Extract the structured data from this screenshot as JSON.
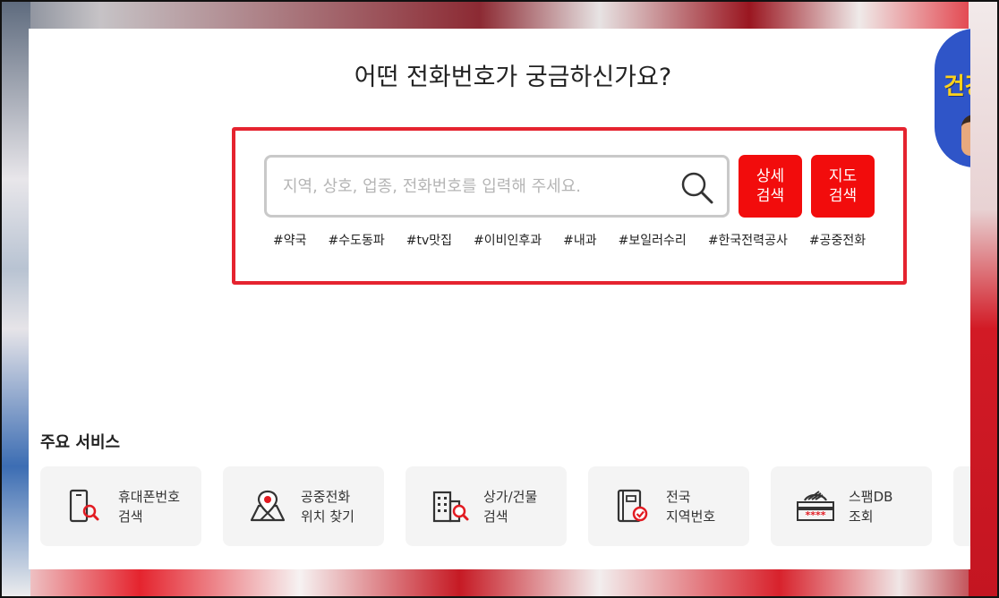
{
  "headline": "어떤 전화번호가 궁금하신가요?",
  "promo": {
    "text": "건강"
  },
  "search": {
    "placeholder": "지역, 상호, 업종, 전화번호를 입력해 주세요.",
    "value": ""
  },
  "buttons": {
    "detail": {
      "line1": "상세",
      "line2": "검색"
    },
    "map": {
      "line1": "지도",
      "line2": "검색"
    }
  },
  "tags": [
    "#약국",
    "#수도동파",
    "#tv맛집",
    "#이비인후과",
    "#내과",
    "#보일러수리",
    "#한국전력공사",
    "#공중전화"
  ],
  "services": {
    "title": "주요 서비스",
    "items": [
      {
        "line1": "휴대폰번호",
        "line2": "검색",
        "icon": "phone-search-icon"
      },
      {
        "line1": "공중전화",
        "line2": "위치 찾기",
        "icon": "map-pin-icon"
      },
      {
        "line1": "상가/건물",
        "line2": "검색",
        "icon": "building-search-icon"
      },
      {
        "line1": "전국",
        "line2": "지역번호",
        "icon": "book-check-icon"
      },
      {
        "line1": "스팸DB",
        "line2": "조회",
        "icon": "spam-db-icon"
      }
    ]
  },
  "colors": {
    "accent": "#f20c0c",
    "highlight_border": "#e5232f",
    "card_bg": "#f4f4f4"
  }
}
